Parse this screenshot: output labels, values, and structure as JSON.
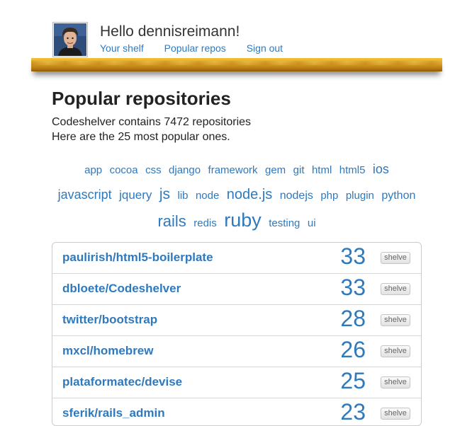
{
  "header": {
    "greeting": "Hello dennisreimann!",
    "nav": [
      "Your shelf",
      "Popular repos",
      "Sign out"
    ]
  },
  "page": {
    "title": "Popular repositories",
    "intro_line1": "Codeshelver contains 7472 repositories",
    "intro_line2": "Here are the 25 most popular ones."
  },
  "tags": [
    {
      "label": "app",
      "size": 15
    },
    {
      "label": "cocoa",
      "size": 15
    },
    {
      "label": "css",
      "size": 15
    },
    {
      "label": "django",
      "size": 15
    },
    {
      "label": "framework",
      "size": 15
    },
    {
      "label": "gem",
      "size": 15
    },
    {
      "label": "git",
      "size": 15
    },
    {
      "label": "html",
      "size": 15
    },
    {
      "label": "html5",
      "size": 15
    },
    {
      "label": "ios",
      "size": 18
    },
    {
      "label": "javascript",
      "size": 18
    },
    {
      "label": "jquery",
      "size": 17
    },
    {
      "label": "js",
      "size": 21
    },
    {
      "label": "lib",
      "size": 15
    },
    {
      "label": "node",
      "size": 15
    },
    {
      "label": "node.js",
      "size": 20
    },
    {
      "label": "nodejs",
      "size": 16
    },
    {
      "label": "php",
      "size": 15
    },
    {
      "label": "plugin",
      "size": 15
    },
    {
      "label": "python",
      "size": 16
    },
    {
      "label": "rails",
      "size": 22
    },
    {
      "label": "redis",
      "size": 15
    },
    {
      "label": "ruby",
      "size": 27
    },
    {
      "label": "testing",
      "size": 15
    },
    {
      "label": "ui",
      "size": 15
    }
  ],
  "repos": [
    {
      "name": "paulirish/html5-boilerplate",
      "count": "33",
      "action": "shelve"
    },
    {
      "name": "dbloete/Codeshelver",
      "count": "33",
      "action": "shelve"
    },
    {
      "name": "twitter/bootstrap",
      "count": "28",
      "action": "shelve"
    },
    {
      "name": "mxcl/homebrew",
      "count": "26",
      "action": "shelve"
    },
    {
      "name": "plataformatec/devise",
      "count": "25",
      "action": "shelve"
    },
    {
      "name": "sferik/rails_admin",
      "count": "23",
      "action": "shelve"
    }
  ]
}
